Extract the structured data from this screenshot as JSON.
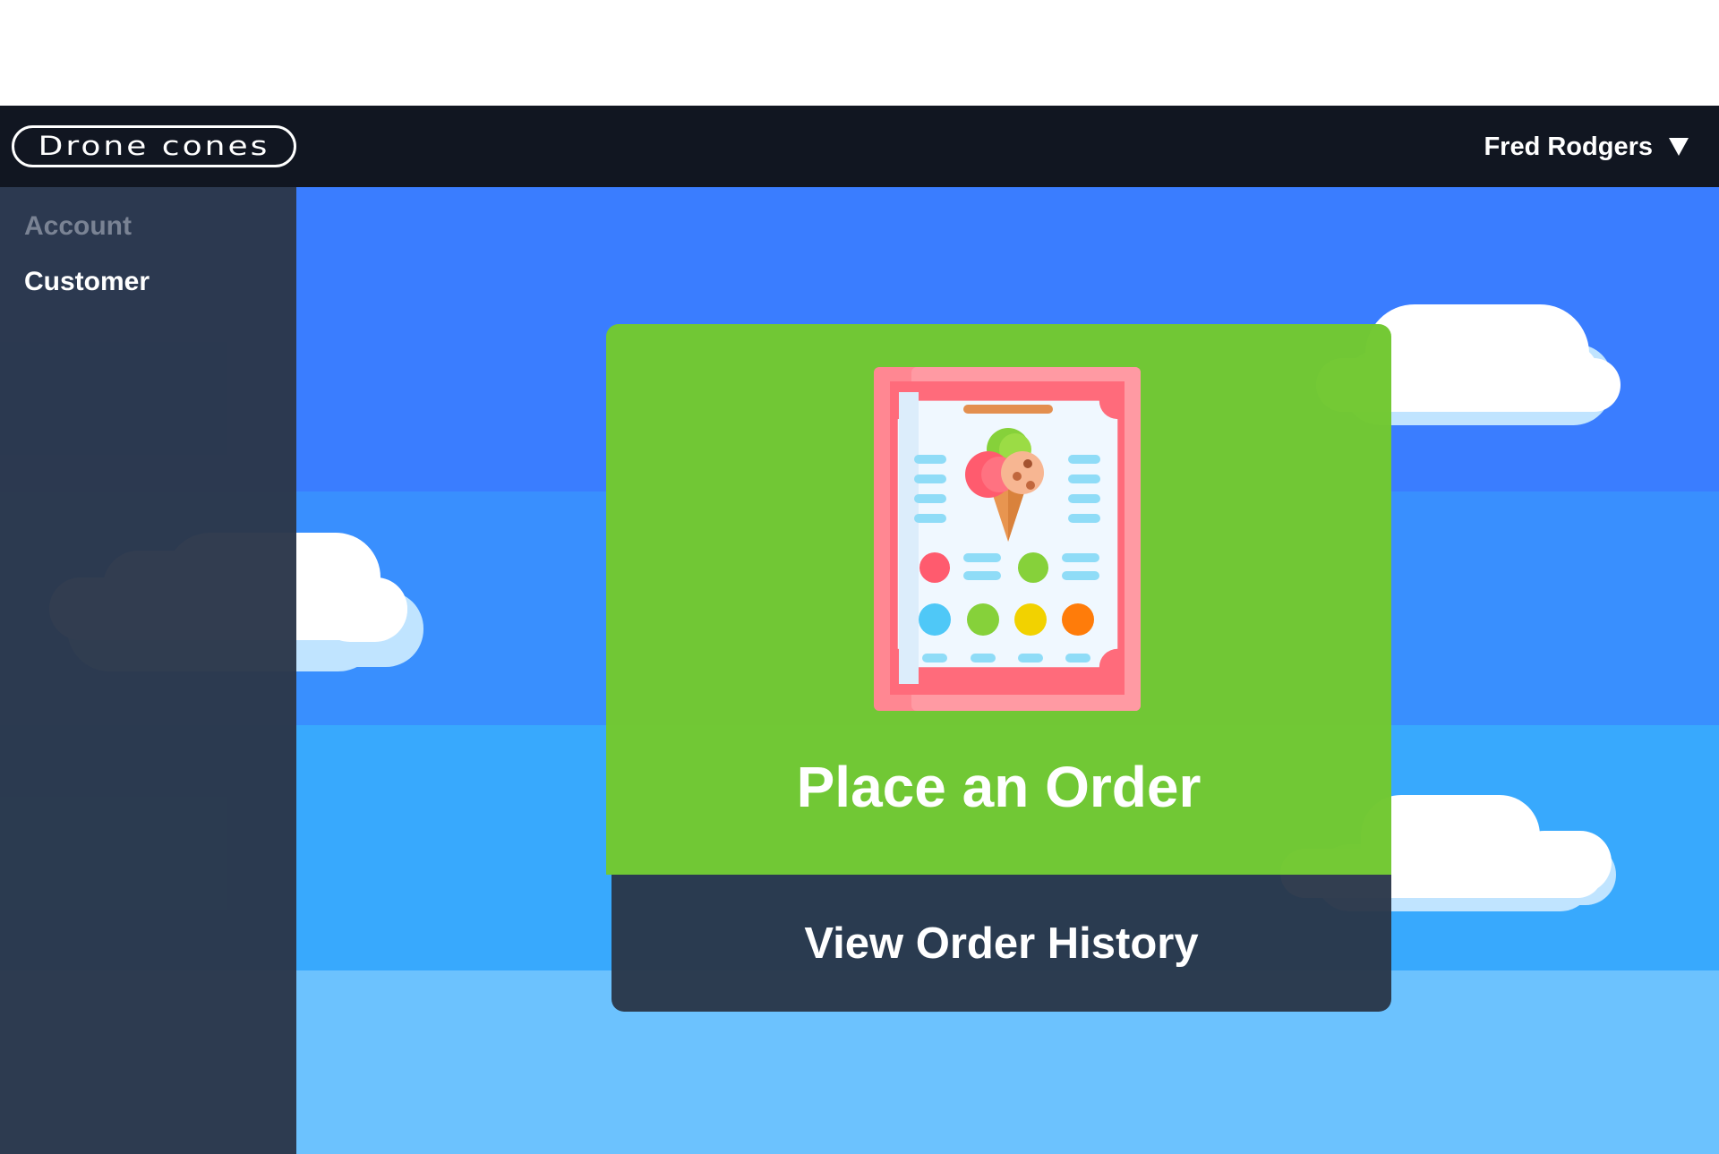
{
  "app": {
    "logo_text": "Drone cones"
  },
  "header": {
    "user_name": "Fred Rodgers",
    "user_menu_icon": "caret-down-icon"
  },
  "sidebar": {
    "heading": "Account",
    "items": [
      {
        "label": "Customer"
      }
    ]
  },
  "main": {
    "place_order": {
      "label": "Place an Order",
      "icon": "ice-cream-menu-icon"
    },
    "view_history": {
      "label": "View Order History"
    }
  },
  "colors": {
    "navbar": "#111621",
    "sidebar": "#2b374a",
    "order_card": "#72c832",
    "history_button": "#2a3649",
    "sky_top": "#3a7dff",
    "sky_bottom": "#6cc2fe"
  }
}
